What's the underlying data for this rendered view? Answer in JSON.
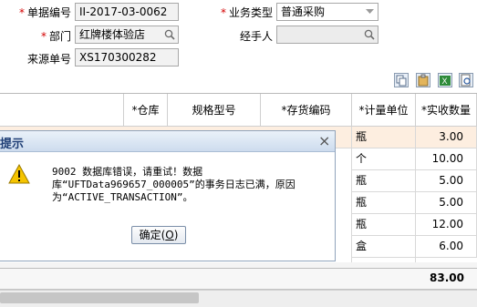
{
  "form": {
    "doc_no_label": "单据编号",
    "doc_no_value": "II-2017-03-0062",
    "biz_type_label": "业务类型",
    "biz_type_value": "普通采购",
    "dept_label": "部门",
    "dept_value": "红牌楼体验店",
    "handler_label": "经手人",
    "handler_value": "",
    "source_label": "来源单号",
    "source_value": "XS170300282"
  },
  "toolbar": {
    "icons": [
      "copy-icon",
      "paste-icon",
      "excel-export-icon",
      "print-preview-icon"
    ]
  },
  "grid": {
    "headers": {
      "warehouse": "*仓库",
      "spec": "规格型号",
      "code": "*存货编码",
      "unit": "*计量单位",
      "qty": "*实收数量"
    },
    "rows": [
      {
        "unit": "瓶",
        "qty": "3.00"
      },
      {
        "unit": "个",
        "qty": "10.00"
      },
      {
        "unit": "瓶",
        "qty": "5.00"
      },
      {
        "unit": "瓶",
        "qty": "5.00"
      },
      {
        "unit": "瓶",
        "qty": "12.00"
      },
      {
        "unit": "盒",
        "qty": "6.00"
      }
    ],
    "total_qty": "83.00"
  },
  "dialog": {
    "title": "提示",
    "close_glyph": "×",
    "message_l1": "9002 数据库错误，请重试！数据",
    "message_l2": "库“UFTData969657_000005”的事务日志已满，原因",
    "message_l3": "为“ACTIVE_TRANSACTION”。",
    "ok_label": "确定(",
    "ok_key": "O",
    "ok_suffix": ")"
  },
  "colors": {
    "required": "#d40000",
    "row_highlight": "#fdeee0",
    "dialog_title_text": "#1f3f76",
    "warning": "#f5c400"
  }
}
